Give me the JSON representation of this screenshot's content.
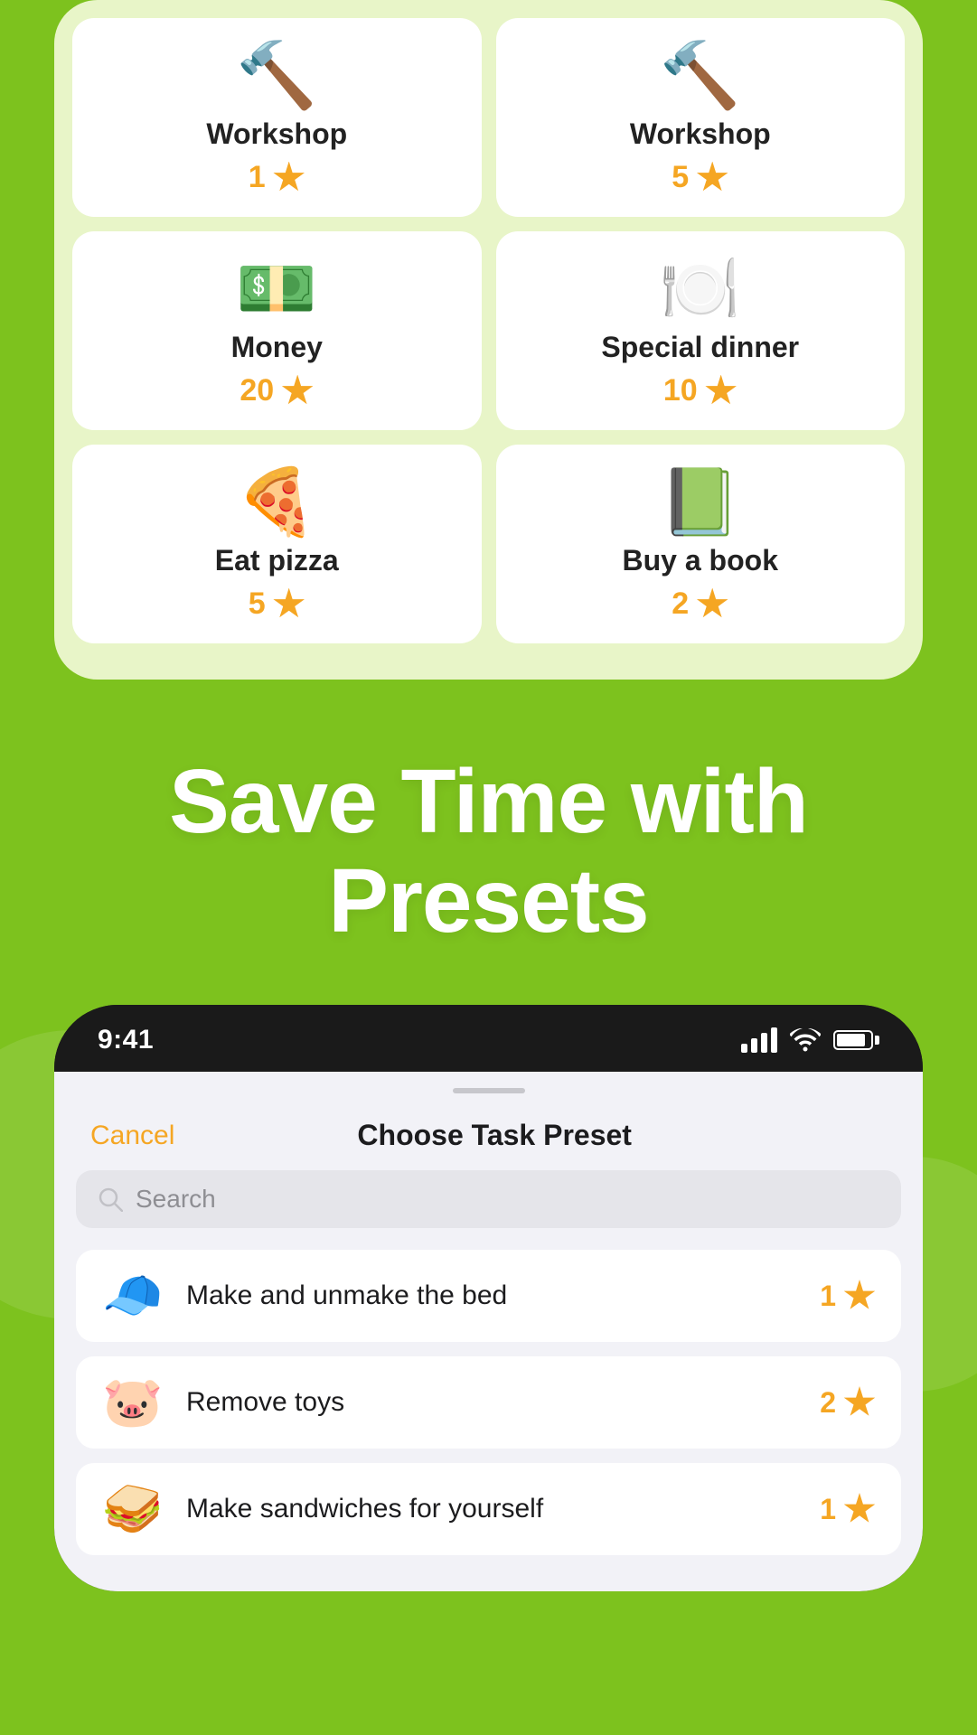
{
  "top_card": {
    "rewards": [
      {
        "id": "workshop1",
        "name": "Workshop",
        "points": "1",
        "icon": "🔨"
      },
      {
        "id": "workshop5",
        "name": "Workshop",
        "points": "5",
        "icon": "🔨"
      },
      {
        "id": "money20",
        "name": "Money",
        "points": "20",
        "icon": "💵"
      },
      {
        "id": "dinner10",
        "name": "Special dinner",
        "points": "10",
        "icon": "🍽️"
      },
      {
        "id": "pizza5",
        "name": "Eat pizza",
        "points": "5",
        "icon": "🍕"
      },
      {
        "id": "book2",
        "name": "Buy a book",
        "points": "2",
        "icon": "📗"
      }
    ]
  },
  "promo": {
    "line1": "Save Time with",
    "line2": "Presets"
  },
  "phone": {
    "status_bar": {
      "time": "9:41"
    },
    "sheet": {
      "cancel_label": "Cancel",
      "title": "Choose Task Preset",
      "search_placeholder": "Search"
    },
    "tasks": [
      {
        "id": "task1",
        "name": "Make and unmake the bed",
        "points": "1",
        "icon": "🧢"
      },
      {
        "id": "task2",
        "name": "Remove toys",
        "points": "2",
        "icon": "🐷"
      },
      {
        "id": "task3",
        "name": "Make sandwiches for yourself",
        "points": "1",
        "icon": "🥪"
      }
    ]
  }
}
